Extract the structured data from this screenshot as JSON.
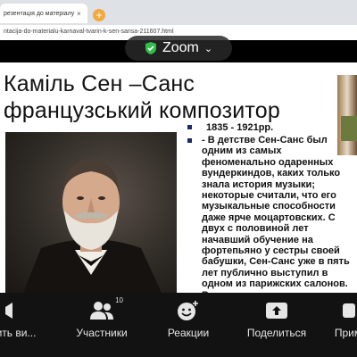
{
  "browser": {
    "tab_title": "резентація до матеріалу \"Кар",
    "tab_close": "×",
    "new_tab": "+",
    "address": "ntacija-do-materialu-karnaval-tvarin-k-sen-sansa-211607.html"
  },
  "zoom": {
    "label": "Zoom",
    "chevron": "⌄",
    "shield_color": "#2fbf4a"
  },
  "slide": {
    "title_line1": "Каміль Сен –Санс",
    "title_line2": "французський композитор",
    "dates": "1835  -  1921рр.",
    "body": "- В детстве Сен-Санс был одним из самых феноменально одаренных вундеркиндов, каких только знала история музыки; некоторые считали, что его музыкальные способности даже ярче моцартовских. С двух с половиной лет начавший обучение на фортепьяно у сестры своей бабушки, Сен-Санс уже в пять лет публично выступил в одном из парижских салонов. В шесть лет он стал сочинять музыку, а в десять состоялся его первый концерт",
    "bullet_color": "#1c2a6b"
  },
  "toolbar": {
    "stop_video": "ить ви...",
    "participants": "Участники",
    "participants_count": "10",
    "reactions": "Реакции",
    "share": "Поделиться",
    "more": "Прим"
  }
}
